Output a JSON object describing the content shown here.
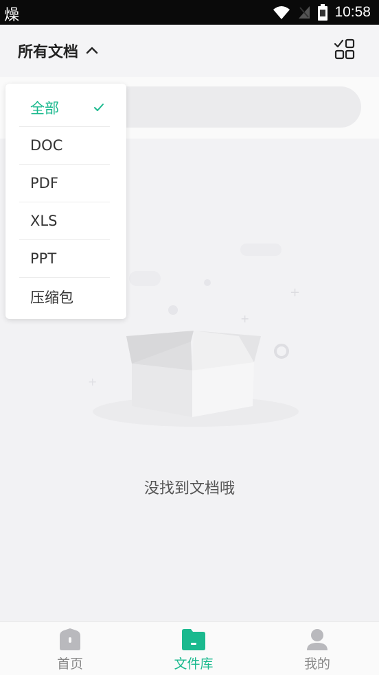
{
  "status_bar": {
    "left_glyph": "燥",
    "time": "10:58",
    "icons": [
      "wifi-icon",
      "signal-off-icon",
      "battery-icon"
    ]
  },
  "header": {
    "title": "所有文档",
    "title_icon": "chevron-up-icon",
    "action_icon": "grid-select-icon"
  },
  "search": {
    "placeholder": ""
  },
  "dropdown": {
    "items": [
      {
        "label": "全部",
        "selected": true
      },
      {
        "label": "DOC",
        "selected": false
      },
      {
        "label": "PDF",
        "selected": false
      },
      {
        "label": "XLS",
        "selected": false
      },
      {
        "label": "PPT",
        "selected": false
      },
      {
        "label": "压缩包",
        "selected": false
      }
    ]
  },
  "empty_state": {
    "message": "没找到文档哦",
    "illustration": "empty-box-illustration"
  },
  "bottom_nav": {
    "items": [
      {
        "label": "首页",
        "icon": "home-icon",
        "active": false
      },
      {
        "label": "文件库",
        "icon": "folder-icon",
        "active": true
      },
      {
        "label": "我的",
        "icon": "profile-icon",
        "active": false
      }
    ]
  },
  "colors": {
    "accent": "#1ab98e",
    "background": "#f2f2f4",
    "status_bar": "#0a0a0a"
  }
}
